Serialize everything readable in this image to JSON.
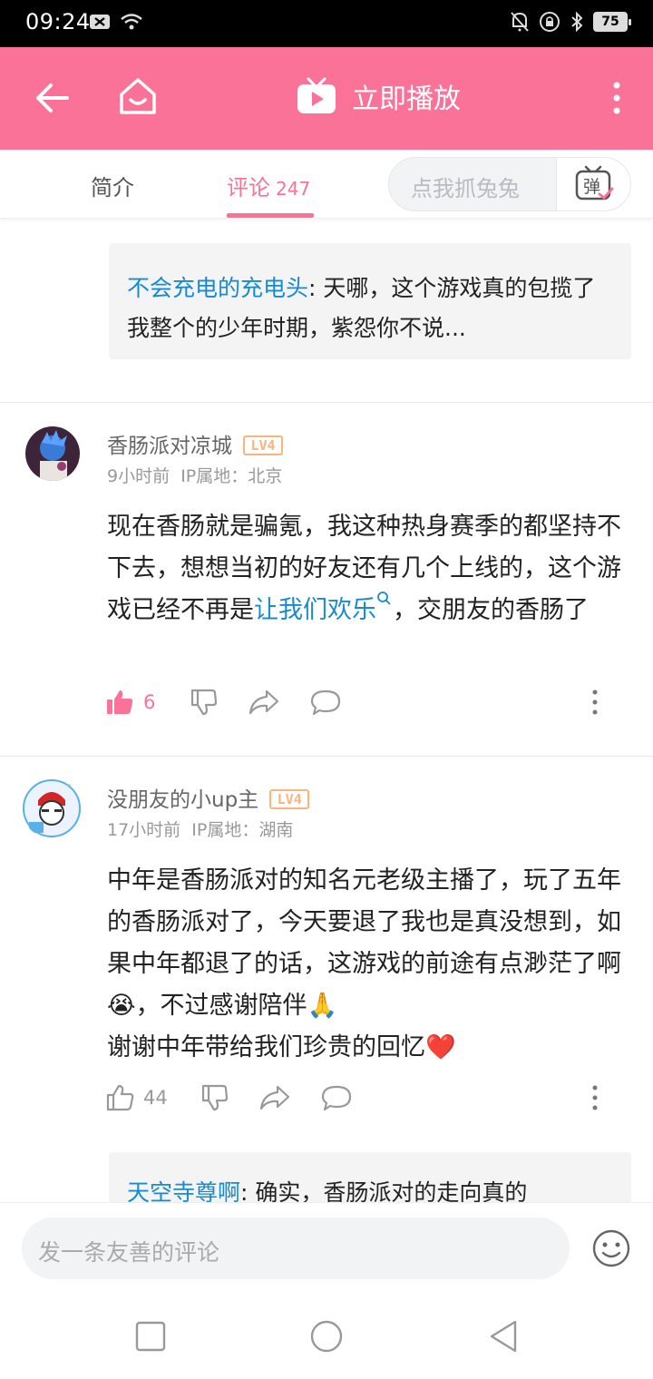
{
  "status_bar": {
    "time": "09:24",
    "battery": "75"
  },
  "header": {
    "play_label": "立即播放"
  },
  "tabs": {
    "intro": "简介",
    "comments": "评论",
    "comments_count": "247",
    "danmaku_placeholder": "点我抓兔兔",
    "danmaku_button": "弹"
  },
  "reply_top": {
    "user": "不会充电的充电头",
    "sep": ": ",
    "text": "天哪，这个游戏真的包揽了我整个的少年时期，紫怨你不说..."
  },
  "comments": [
    {
      "name": "香肠派对凉城",
      "level": "LV4",
      "time": "9小时前",
      "ip": "IP属地：北京",
      "text_before": "现在香肠就是骗氪，我这种热身赛季的都坚持不下去，想想当初的好友还有几个上线的，这个游戏已经不再是",
      "link": "让我们欢乐",
      "text_after": "，交朋友的香肠了",
      "likes": "6"
    },
    {
      "name": "没朋友的小up主",
      "level": "LV4",
      "time": "17小时前",
      "ip": "IP属地：湖南",
      "text_line1": "中年是香肠派对的知名元老级主播了，玩了五年的香肠派对了，今天要退了我也是真没想到，如果中年都退了的话，这游戏的前途有点渺茫了啊",
      "emoji1": "😭",
      "text_line2": "，不过感谢陪伴",
      "emoji2": "🙏",
      "text_line3": "谢谢中年带给我们珍贵的回忆",
      "emoji3": "❤️",
      "likes": "44"
    }
  ],
  "reply_bottom": {
    "user": "天空寺尊啊",
    "sep": ": ",
    "text": "确实，香肠派对的走向真的"
  },
  "bottom_bar": {
    "placeholder": "发一条友善的评论"
  },
  "colors": {
    "accent": "#fb7299",
    "link": "#178bcf",
    "level": "#ffb37c"
  }
}
